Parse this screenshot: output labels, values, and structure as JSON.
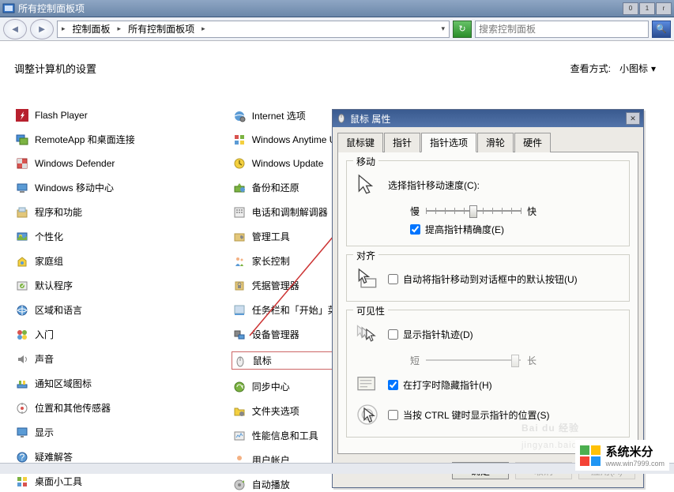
{
  "window": {
    "title": "所有控制面板项",
    "min_glyph": "0",
    "max_glyph": "1",
    "close_glyph": "r"
  },
  "nav": {
    "back_glyph": "◄",
    "fwd_glyph": "►",
    "crumb1": "控制面板",
    "crumb2": "所有控制面板项",
    "refresh_glyph": "↻",
    "search_placeholder": "搜索控制面板",
    "search_glyph": "🔍"
  },
  "header": {
    "title": "调整计算机的设置",
    "view_label": "查看方式:",
    "view_value": "小图标",
    "view_arrow": "▾"
  },
  "col1": [
    {
      "k": "flash",
      "label": "Flash Player"
    },
    {
      "k": "remoteapp",
      "label": "RemoteApp 和桌面连接"
    },
    {
      "k": "defender",
      "label": "Windows Defender"
    },
    {
      "k": "mobility",
      "label": "Windows 移动中心"
    },
    {
      "k": "programs",
      "label": "程序和功能"
    },
    {
      "k": "personal",
      "label": "个性化"
    },
    {
      "k": "homegroup",
      "label": "家庭组"
    },
    {
      "k": "defaults",
      "label": "默认程序"
    },
    {
      "k": "region",
      "label": "区域和语言"
    },
    {
      "k": "getstarted",
      "label": "入门"
    },
    {
      "k": "sound",
      "label": "声音"
    },
    {
      "k": "notifyicons",
      "label": "通知区域图标"
    },
    {
      "k": "sensors",
      "label": "位置和其他传感器"
    },
    {
      "k": "display",
      "label": "显示"
    },
    {
      "k": "troubleshoot",
      "label": "疑难解答"
    },
    {
      "k": "gadgets",
      "label": "桌面小工具"
    }
  ],
  "col2": [
    {
      "k": "inetopt",
      "label": "Internet 选项"
    },
    {
      "k": "anytime",
      "label": "Windows Anytime Upgrade"
    },
    {
      "k": "update",
      "label": "Windows Update"
    },
    {
      "k": "backup",
      "label": "备份和还原"
    },
    {
      "k": "phone",
      "label": "电话和调制解调器"
    },
    {
      "k": "admintools",
      "label": "管理工具"
    },
    {
      "k": "parental",
      "label": "家长控制"
    },
    {
      "k": "credmgr",
      "label": "凭据管理器"
    },
    {
      "k": "taskbar",
      "label": "任务栏和「开始」菜单"
    },
    {
      "k": "devmgr",
      "label": "设备管理器"
    },
    {
      "k": "mouse",
      "label": "鼠标",
      "hl": true
    },
    {
      "k": "sync",
      "label": "同步中心"
    },
    {
      "k": "folderopt",
      "label": "文件夹选项"
    },
    {
      "k": "perfinfo",
      "label": "性能信息和工具"
    },
    {
      "k": "useracct",
      "label": "用户帐户"
    },
    {
      "k": "autoplay",
      "label": "自动播放"
    }
  ],
  "dialog": {
    "title": "鼠标 属性",
    "close_glyph": "✕",
    "tabs": [
      "鼠标键",
      "指针",
      "指针选项",
      "滑轮",
      "硬件"
    ],
    "active_tab": 2,
    "grp_motion": {
      "legend": "移动",
      "speed_label": "选择指针移动速度(C):",
      "slow": "慢",
      "fast": "快",
      "precision": "提高指针精确度(E)",
      "precision_checked": true
    },
    "grp_snap": {
      "legend": "对齐",
      "snap_label": "自动将指针移动到对话框中的默认按钮(U)",
      "snap_checked": false
    },
    "grp_vis": {
      "legend": "可见性",
      "trails": "显示指针轨迹(D)",
      "trails_checked": false,
      "short": "短",
      "long": "长",
      "hide": "在打字时隐藏指针(H)",
      "hide_checked": true,
      "ctrl": "当按 CTRL 键时显示指针的位置(S)",
      "ctrl_checked": false
    },
    "ok": "确定",
    "cancel": "取消",
    "apply": "应用(A)"
  },
  "watermark1": "Bai du 经验",
  "watermark1_sub": "jingyan.baid",
  "watermark2": {
    "brand": "系统米分",
    "url": "www.win7999.com"
  }
}
